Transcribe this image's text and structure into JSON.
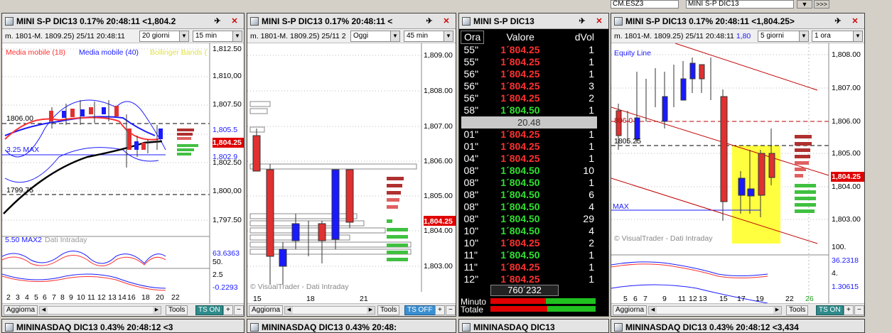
{
  "toolbar": {
    "symbol": "CM.ESZ3",
    "symbol2": "MINI S-P DIC13",
    "btn": ">>>"
  },
  "win1": {
    "title": "MINI S-P DIC13 0.17% 20:48:11 <1,804.2",
    "info": "m. 1801-M. 1809.25) 25/11 20:48:11",
    "period": "20 giorni",
    "interval": "15 min",
    "legend_ma18": "Media mobile (18)",
    "legend_ma40": "Media mobile (40)",
    "legend_bb": "Bollinger Bands (",
    "yticks": [
      "1,812.50",
      "1,810,00",
      "1,807.50",
      "1,805.5",
      "1,802.9",
      "1,802.50",
      "1,800,00",
      "1,797.50"
    ],
    "price": "1,804.25",
    "lbl_1806": "1806.00",
    "lbl_325": "3.25 MAX",
    "lbl_1799": "1799.75",
    "osc_label": "5.50 MAX2",
    "osc_val": "63.6363",
    "osc2_val": "-0.2293",
    "osc_tick1": "50.",
    "osc_tick2": "2.5",
    "watermark": "Dati Intraday",
    "xticks": [
      "2",
      "3",
      "4",
      "5",
      "6",
      "7",
      "8",
      "9",
      "10",
      "11",
      "12",
      "13",
      "14",
      "15",
      "16",
      "18",
      "19",
      "20",
      "22"
    ],
    "aggiorna": "Aggiorna",
    "tools": "Tools",
    "ts": "TS ON"
  },
  "win2": {
    "title": "MINI S-P DIC13 0.17% 20:48:11 <",
    "info": "m. 1801-M. 1809.25) 25/11 2",
    "period": "Oggi",
    "interval": "45 min",
    "yticks": [
      "1,809.00",
      "1,808.00",
      "1,807.00",
      "1,806.00",
      "1,805.00",
      "1,804.00",
      "1,803.00"
    ],
    "price": "1,804.25",
    "watermark": "© VisualTrader - Dati Intraday",
    "xticks": [
      "15",
      "18",
      "21"
    ],
    "aggiorna": "Aggiorna",
    "tools": "Tools",
    "ts": "TS OFF"
  },
  "win3": {
    "title": "MINI S-P DIC13",
    "headers": [
      "Ora",
      "Valore",
      "dVol"
    ],
    "rows_top": [
      {
        "t": "55\"",
        "v": "1´804.25",
        "d": "1",
        "c": "r"
      },
      {
        "t": "55\"",
        "v": "1´804.25",
        "d": "1",
        "c": "r"
      },
      {
        "t": "56\"",
        "v": "1´804.25",
        "d": "1",
        "c": "r"
      },
      {
        "t": "56\"",
        "v": "1´804.25",
        "d": "3",
        "c": "r"
      },
      {
        "t": "56\"",
        "v": "1´804.25",
        "d": "2",
        "c": "r"
      },
      {
        "t": "58\"",
        "v": "1´804.50",
        "d": "1",
        "c": "g"
      }
    ],
    "separator": "20.48",
    "rows_bottom": [
      {
        "t": "01\"",
        "v": "1´804.25",
        "d": "1",
        "c": "r"
      },
      {
        "t": "01\"",
        "v": "1´804.25",
        "d": "1",
        "c": "r"
      },
      {
        "t": "04\"",
        "v": "1´804.25",
        "d": "1",
        "c": "r"
      },
      {
        "t": "08\"",
        "v": "1´804.50",
        "d": "10",
        "c": "g"
      },
      {
        "t": "08\"",
        "v": "1´804.50",
        "d": "1",
        "c": "g"
      },
      {
        "t": "08\"",
        "v": "1´804.50",
        "d": "6",
        "c": "g"
      },
      {
        "t": "08\"",
        "v": "1´804.50",
        "d": "4",
        "c": "g"
      },
      {
        "t": "08\"",
        "v": "1´804.50",
        "d": "29",
        "c": "g"
      },
      {
        "t": "10\"",
        "v": "1´804.50",
        "d": "4",
        "c": "g"
      },
      {
        "t": "10\"",
        "v": "1´804.25",
        "d": "2",
        "c": "r"
      },
      {
        "t": "11\"",
        "v": "1´804.50",
        "d": "1",
        "c": "g"
      },
      {
        "t": "11\"",
        "v": "1´804.25",
        "d": "1",
        "c": "r"
      },
      {
        "t": "12\"",
        "v": "1´804.25",
        "d": "1",
        "c": "r"
      }
    ],
    "total_vol": "760´232",
    "minuto": "Minuto",
    "totale": "Totale"
  },
  "win4": {
    "title": "MINI S-P DIC13 0.17% 20:48:11 <1,804.25>",
    "info": "m. 1801-M. 1809.25) 25/11 20:48:11",
    "info2": "1,80",
    "period": "5 giorni",
    "interval": "1 ora",
    "legend": "Equity Line",
    "yticks": [
      "1,808.00",
      "1,807.00",
      "1,806.00",
      "1,805.00",
      "1,804.00",
      "1,803.00"
    ],
    "price": "1,804.25",
    "lbl_806": "806.0",
    "lbl_1805": "1805.25",
    "lbl_max": "MAX",
    "watermark": "© VisualTrader - Dati Intraday",
    "osc_val": "36.2318",
    "osc2_val": "1.30615",
    "osc_tick": "100.",
    "osc_tick2": "4.",
    "xticks": [
      "5",
      "6",
      "7",
      "9",
      "11",
      "12",
      "13",
      "15",
      "17",
      "19",
      "22",
      "26"
    ],
    "aggiorna": "Aggiorna",
    "tools": "Tools",
    "ts": "TS ON"
  },
  "bottom_titles": [
    "MININASDAQ DIC13 0.43% 20:48:12 <3",
    "MININASDAQ DIC13 0.43% 20:48:",
    "MININASDAQ DIC13",
    "MININASDAQ DIC13 0.43% 20:48:12 <3,434"
  ]
}
